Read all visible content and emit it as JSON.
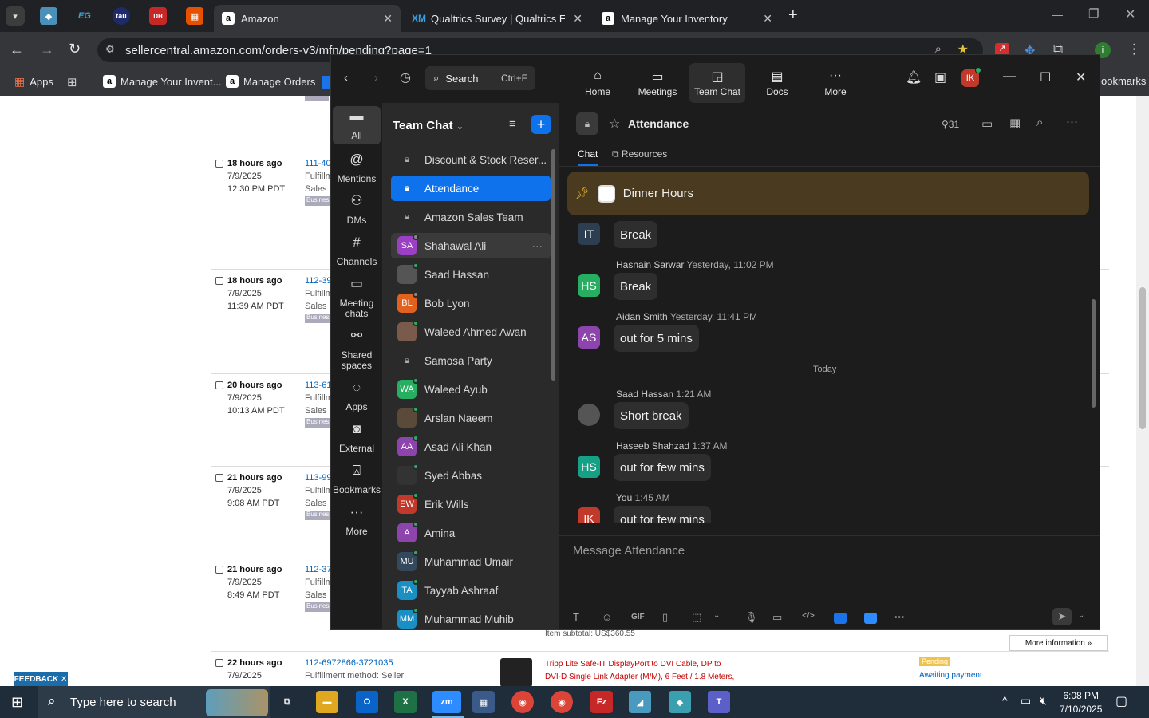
{
  "browser": {
    "tabs": [
      {
        "label": "Amazon",
        "active": true
      },
      {
        "label": "Qualtrics Survey | Qualtrics Exp",
        "active": false
      },
      {
        "label": "Manage Your Inventory",
        "active": false
      }
    ],
    "pinned_tabs": [
      "EG",
      "tau",
      "DH"
    ],
    "url": "sellercentral.amazon.com/orders-v3/mfn/pending?page=1",
    "bookmarks": [
      "Apps",
      "Manage Your Invent...",
      "Manage Orders"
    ],
    "bookmarks_right": "ookmarks"
  },
  "amazon": {
    "orders": [
      {
        "age": "18 hours ago",
        "date": "7/9/2025",
        "time": "12:30 PM PDT",
        "id": "111-40",
        "fulfil": "Fulfillm",
        "sales": "Sales ch",
        "badge": "Business"
      },
      {
        "age": "18 hours ago",
        "date": "7/9/2025",
        "time": "11:39 AM PDT",
        "id": "112-39",
        "fulfil": "Fulfillm",
        "sales": "Sales ch",
        "badge": "Business"
      },
      {
        "age": "20 hours ago",
        "date": "7/9/2025",
        "time": "10:13 AM PDT",
        "id": "113-61",
        "fulfil": "Fulfillm",
        "sales": "Sales ch",
        "badge": "Business"
      },
      {
        "age": "21 hours ago",
        "date": "7/9/2025",
        "time": "9:08 AM PDT",
        "id": "113-99",
        "fulfil": "Fulfillm",
        "sales": "Sales ch",
        "badge": "Business"
      },
      {
        "age": "21 hours ago",
        "date": "7/9/2025",
        "time": "8:49 AM PDT",
        "id": "112-37",
        "fulfil": "Fulfillm",
        "sales": "Sales ch",
        "badge": "Business"
      }
    ],
    "last_order": {
      "age": "22 hours ago",
      "date": "7/9/2025",
      "id": "112-6972866-3721035",
      "fulfil": "Fulfillment method: Seller",
      "product_line1": "Tripp Lite Safe-IT DisplayPort to DVI Cable, DP to",
      "product_line2": "DVI-D Single Link Adapter (M/M), 6 Feet / 1.8 Meters,",
      "status_badge": "Pending",
      "status": "Awaiting payment"
    },
    "item_subtotal": "Item subtotal: US$360.55",
    "more_info": "More information »",
    "feedback": "FEEDBACK"
  },
  "zoom": {
    "search": {
      "label": "Search",
      "shortcut": "Ctrl+F"
    },
    "nav": [
      {
        "label": "Home",
        "icon": "home-icon"
      },
      {
        "label": "Meetings",
        "icon": "video-icon"
      },
      {
        "label": "Team Chat",
        "icon": "chat-icon"
      },
      {
        "label": "Docs",
        "icon": "doc-icon"
      },
      {
        "label": "More",
        "icon": "more-icon"
      }
    ],
    "user_initials": "IK",
    "rail": [
      "All",
      "Mentions",
      "DMs",
      "Channels",
      "Meeting chats",
      "Shared spaces",
      "Apps",
      "External",
      "Bookmarks",
      "More"
    ],
    "list_title": "Team Chat",
    "list": [
      {
        "name": "Discount & Stock Reser...",
        "type": "channel"
      },
      {
        "name": "Attendance",
        "type": "channel"
      },
      {
        "name": "Amazon Sales Team",
        "type": "channel"
      },
      {
        "name": "Shahawal Ali",
        "type": "dm",
        "initials": "SA",
        "color": "#9b3fc4"
      },
      {
        "name": "Saad Hassan",
        "type": "dm",
        "initials": "",
        "color": "#555555"
      },
      {
        "name": "Bob Lyon",
        "type": "dm",
        "initials": "BL",
        "color": "#e0621e"
      },
      {
        "name": "Waleed Ahmed Awan",
        "type": "dm",
        "initials": "",
        "color": "#7a5a4a"
      },
      {
        "name": "Samosa Party",
        "type": "channel"
      },
      {
        "name": "Waleed Ayub",
        "type": "dm",
        "initials": "WA",
        "color": "#27ae60"
      },
      {
        "name": "Arslan Naeem",
        "type": "dm",
        "initials": "",
        "color": "#5a4a3a"
      },
      {
        "name": "Asad Ali Khan",
        "type": "dm",
        "initials": "AA",
        "color": "#8e44ad"
      },
      {
        "name": "Syed Abbas",
        "type": "dm",
        "initials": "",
        "color": "#333333"
      },
      {
        "name": "Erik Wills",
        "type": "dm",
        "initials": "EW",
        "color": "#c0392b"
      },
      {
        "name": "Amina",
        "type": "dm",
        "initials": "A",
        "color": "#8e44ad"
      },
      {
        "name": "Muhammad Umair",
        "type": "dm",
        "initials": "MU",
        "color": "#34495e"
      },
      {
        "name": "Tayyab Ashraaf",
        "type": "dm",
        "initials": "TA",
        "color": "#1a8fc4"
      },
      {
        "name": "Muhammad Muhib",
        "type": "dm",
        "initials": "MM",
        "color": "#1a8fc4"
      }
    ],
    "channel": {
      "title": "Attendance",
      "members": "31",
      "tabs": [
        "Chat",
        "Resources"
      ],
      "pinned": "Dinner Hours",
      "today_label": "Today",
      "messages": [
        {
          "initials": "IT",
          "name": "",
          "time": "",
          "text": "Break",
          "color": "#2c3e50"
        },
        {
          "initials": "HS",
          "name": "Hasnain Sarwar",
          "time": "Yesterday, 11:02 PM",
          "text": "Break",
          "color": "#27ae60"
        },
        {
          "initials": "AS",
          "name": "Aidan Smith",
          "time": "Yesterday, 11:41 PM",
          "text": "out for 5 mins",
          "color": "#8e44ad"
        },
        {
          "initials": "",
          "name": "Saad Hassan",
          "time": "1:21 AM",
          "text": "Short break",
          "color": "#555555"
        },
        {
          "initials": "HS",
          "name": "Haseeb Shahzad",
          "time": "1:37 AM",
          "text": "out for few mins",
          "color": "#16a085"
        },
        {
          "initials": "IK",
          "name": "You",
          "time": "1:45 AM",
          "text": "out for few mins",
          "color": "#c0392b"
        }
      ],
      "composer_placeholder": "Message Attendance"
    }
  },
  "taskbar": {
    "search": "Type here to search",
    "time": "6:08 PM",
    "date": "7/10/2025"
  }
}
